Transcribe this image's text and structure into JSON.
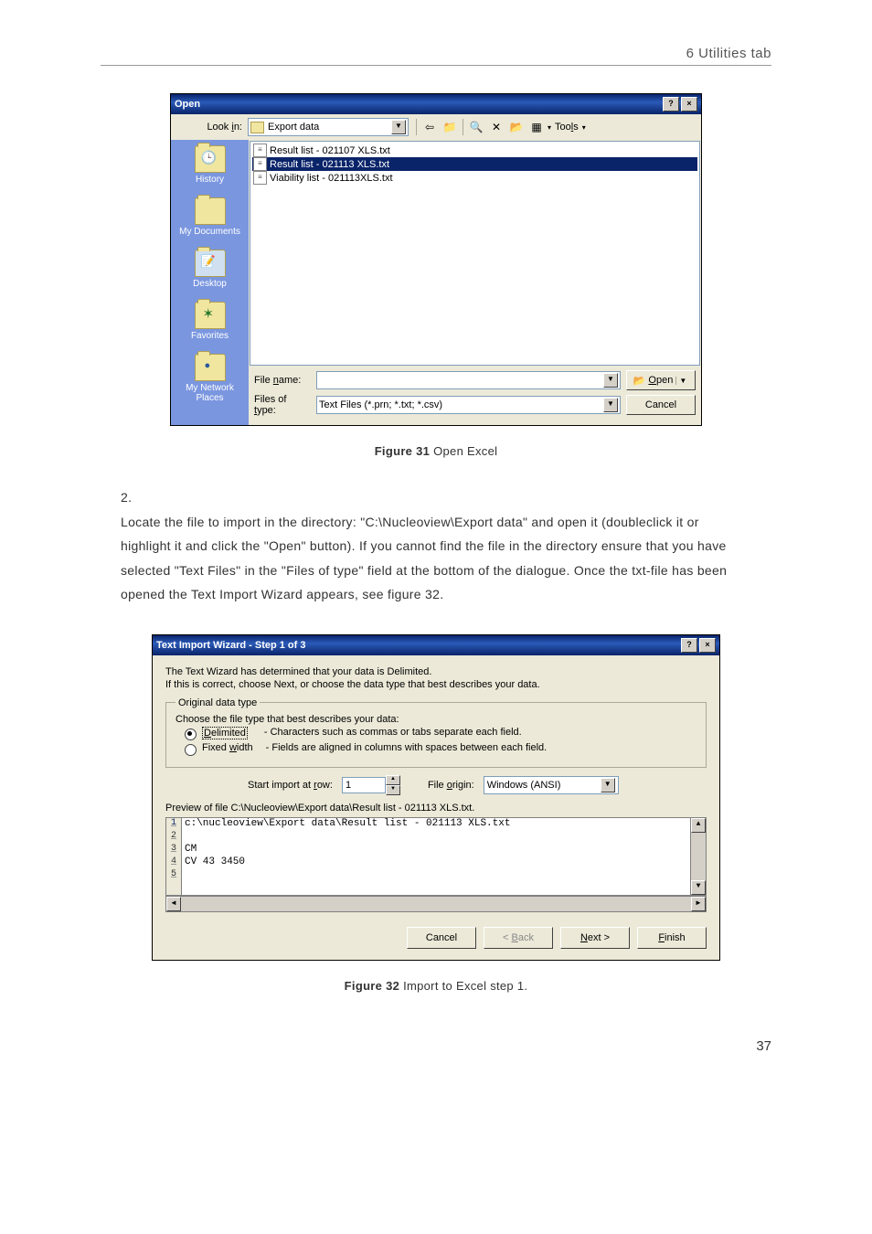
{
  "header": {
    "section": "6 Utilities tab"
  },
  "page_number": "37",
  "figure31": {
    "caption_bold": "Figure 31",
    "caption_rest": " Open Excel"
  },
  "figure32": {
    "caption_bold": "Figure 32",
    "caption_rest": " Import to Excel step 1."
  },
  "step": {
    "num": "2.",
    "text": "Locate the file to import in the directory: \"C:\\Nucleoview\\Export data\" and open it (doubleclick it or highlight it and click the \"Open\" button). If you cannot find the file in the directory ensure that you have selected \"Text Files\" in the \"Files of type\" field at the bottom of the dialogue. Once the txt-file has been opened the Text Import Wizard appears, see figure 32."
  },
  "open_dialog": {
    "title": "Open",
    "lookin_label": "Look in:",
    "lookin_value": "Export data",
    "tools_label": "Tools",
    "places": {
      "history": "History",
      "documents": "My Documents",
      "desktop": "Desktop",
      "favorites": "Favorites",
      "network": "My Network Places"
    },
    "files": [
      "Result list - 021107 XLS.txt",
      "Result list - 021113 XLS.txt",
      "Viability list - 021113XLS.txt"
    ],
    "filename_label": "File name:",
    "filetype_label": "Files of type:",
    "filetype_value": "Text Files (*.prn; *.txt; *.csv)",
    "open_btn": "Open",
    "cancel_btn": "Cancel"
  },
  "wizard": {
    "title": "Text Import Wizard - Step 1 of 3",
    "intro1": "The Text Wizard has determined that your data is Delimited.",
    "intro2": "If this is correct, choose Next, or choose the data type that best describes your data.",
    "groupbox": "Original data type",
    "choose": "Choose the file type that best describes your data:",
    "delimited_label": "Delimited",
    "delimited_desc": "- Characters such as commas or tabs separate each field.",
    "fixed_label": "Fixed width",
    "fixed_desc": "- Fields are aligned in columns with spaces between each field.",
    "start_row_label": "Start import at row:",
    "start_row_value": "1",
    "file_origin_label": "File origin:",
    "file_origin_value": "Windows (ANSI)",
    "preview_label": "Preview of file C:\\Nucleoview\\Export data\\Result list - 021113 XLS.txt.",
    "preview_lines": [
      "c:\\nucleoview\\Export data\\Result list - 021113 XLS.txt",
      "",
      "CM",
      "CV 43 3450",
      ""
    ],
    "btn_cancel": "Cancel",
    "btn_back": "< Back",
    "btn_next": "Next >",
    "btn_finish": "Finish"
  }
}
